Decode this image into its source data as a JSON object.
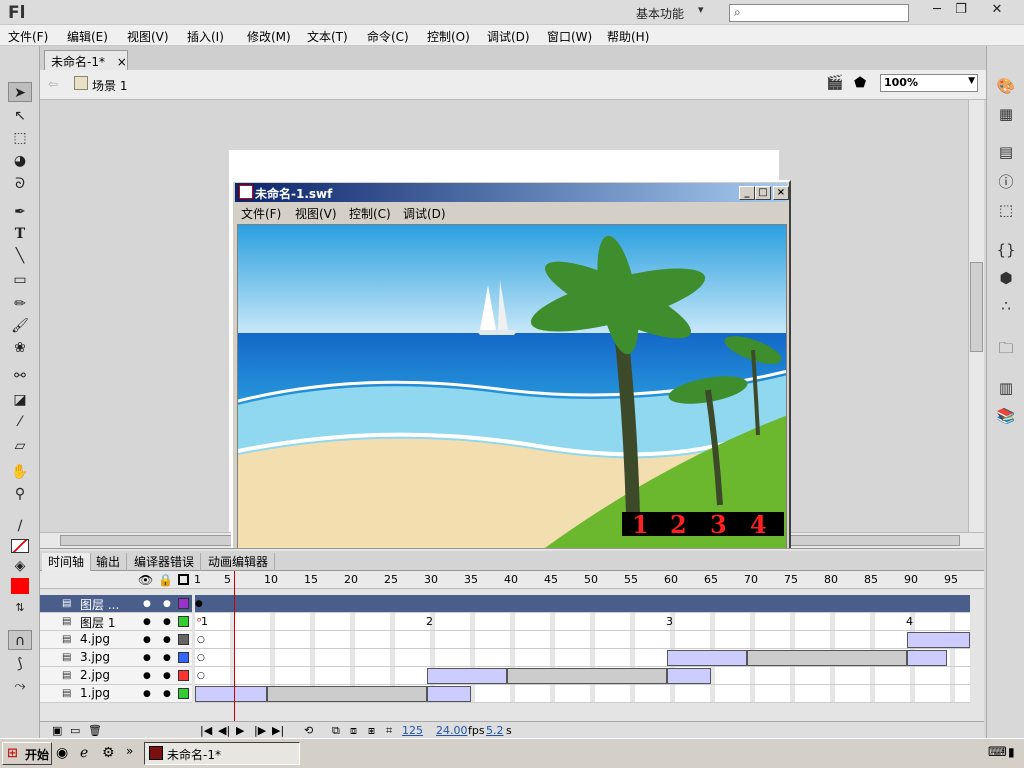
{
  "app": {
    "logo": "Fl",
    "workspace": "基本功能",
    "workspace_arrow": "▾"
  },
  "window_buttons": {
    "minimize": "─",
    "restore": "❐",
    "close": "✕"
  },
  "menu": [
    "文件(F)",
    "编辑(E)",
    "视图(V)",
    "插入(I)",
    "修改(M)",
    "文本(T)",
    "命令(C)",
    "控制(O)",
    "调试(D)",
    "窗口(W)",
    "帮助(H)"
  ],
  "doc_tab": {
    "label": "未命名-1*",
    "close": "×"
  },
  "editbar": {
    "scene": "场景 1",
    "zoom": "100%"
  },
  "swf_window": {
    "title": "未命名-1.swf",
    "menu": [
      "文件(F)",
      "视图(V)",
      "控制(C)",
      "调试(D)"
    ],
    "numbers": [
      "1",
      "2",
      "3",
      "4"
    ]
  },
  "timeline": {
    "tabs": [
      "时间轴",
      "输出",
      "编译器错误",
      "动画编辑器"
    ],
    "frame_numbers": [
      "1",
      "5",
      "10",
      "15",
      "20",
      "25",
      "30",
      "35",
      "40",
      "45",
      "50",
      "55",
      "60",
      "65",
      "70",
      "75",
      "80",
      "85",
      "90",
      "95"
    ],
    "layers": [
      {
        "name": "图层 ...",
        "color": "#9933cc",
        "selected": true
      },
      {
        "name": "图层 1",
        "color": "#33cc33",
        "labels": [
          "1",
          "2",
          "3",
          "4"
        ]
      },
      {
        "name": "4.jpg",
        "color": "#666666"
      },
      {
        "name": "3.jpg",
        "color": "#3366ff"
      },
      {
        "name": "2.jpg",
        "color": "#ff3333"
      },
      {
        "name": "1.jpg",
        "color": "#33cc33"
      }
    ],
    "footer": {
      "frame": "125",
      "fps": "24.00",
      "fps_unit": "fps",
      "time": "5.2",
      "time_unit": "s"
    }
  },
  "taskbar": {
    "start": "开始",
    "task": "未命名-1*",
    "arrows": "»"
  }
}
